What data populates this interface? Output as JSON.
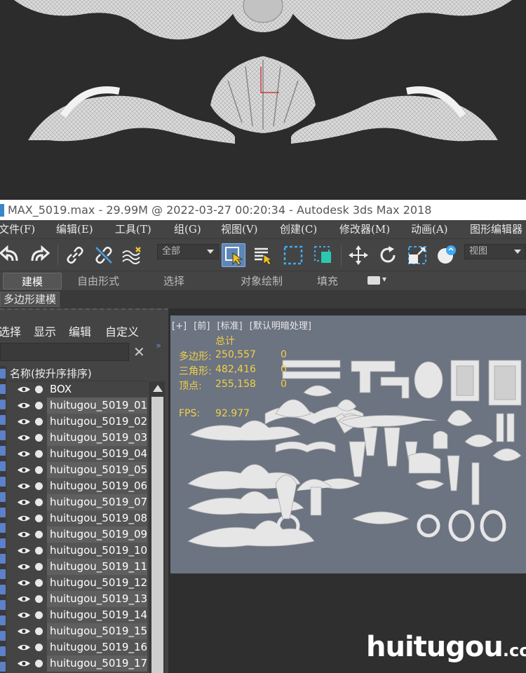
{
  "window": {
    "title": "MAX_5019.max - 29.99M @ 2022-03-27 00:20:34 - Autodesk 3ds Max 2018"
  },
  "menu": [
    "文件(F)",
    "编辑(E)",
    "工具(T)",
    "组(G)",
    "视图(V)",
    "创建(C)",
    "修改器(M)",
    "动画(A)",
    "图形编辑器"
  ],
  "toolbar": {
    "selection_filter": "全部",
    "ref_coord": "视图",
    "icons": [
      "undo-icon",
      "redo-icon",
      "link-icon",
      "unlink-icon",
      "bind-spacewarp-icon",
      "select-object-icon",
      "select-by-name-icon",
      "rect-region-icon",
      "window-crossing-icon",
      "move-icon",
      "rotate-icon",
      "scale-icon",
      "placement-icon"
    ]
  },
  "ribbon": {
    "tabs": [
      "建模",
      "自由形式",
      "选择",
      "对象绘制",
      "填充"
    ],
    "active": "建模",
    "sub_label": "多边形建模"
  },
  "explorer": {
    "tabs": [
      "选择",
      "显示",
      "编辑",
      "自定义"
    ],
    "clear_symbol": "✕",
    "collapse_symbol": "»",
    "column_header": "名称(按升序排序)",
    "rows": [
      "BOX",
      "huitugou_5019_01",
      "huitugou_5019_02",
      "huitugou_5019_03",
      "huitugou_5019_04",
      "huitugou_5019_05",
      "huitugou_5019_06",
      "huitugou_5019_07",
      "huitugou_5019_08",
      "huitugou_5019_09",
      "huitugou_5019_10",
      "huitugou_5019_11",
      "huitugou_5019_12",
      "huitugou_5019_13",
      "huitugou_5019_14",
      "huitugou_5019_15",
      "huitugou_5019_16",
      "huitugou_5019_17"
    ]
  },
  "viewport": {
    "labels": [
      "[+]",
      "[前]",
      "[标准]",
      "[默认明暗处理]"
    ],
    "stats": {
      "total_label": "总计",
      "rows": [
        {
          "label": "多边形:",
          "total": "250,557",
          "selected": "0"
        },
        {
          "label": "三角形:",
          "total": "482,416",
          "selected": "0"
        },
        {
          "label": "顶点:",
          "total": "255,158",
          "selected": "0"
        }
      ],
      "fps_label": "FPS:",
      "fps_value": "92.977"
    }
  },
  "watermark": {
    "main": "huitugou",
    "suffix": ".com"
  },
  "colors": {
    "ui_bg": "#444444",
    "viewport_bg": "#6c7381",
    "stats_text": "#f1d145",
    "active_tool": "#5d86b8",
    "accent_blue": "#5b82c8"
  }
}
